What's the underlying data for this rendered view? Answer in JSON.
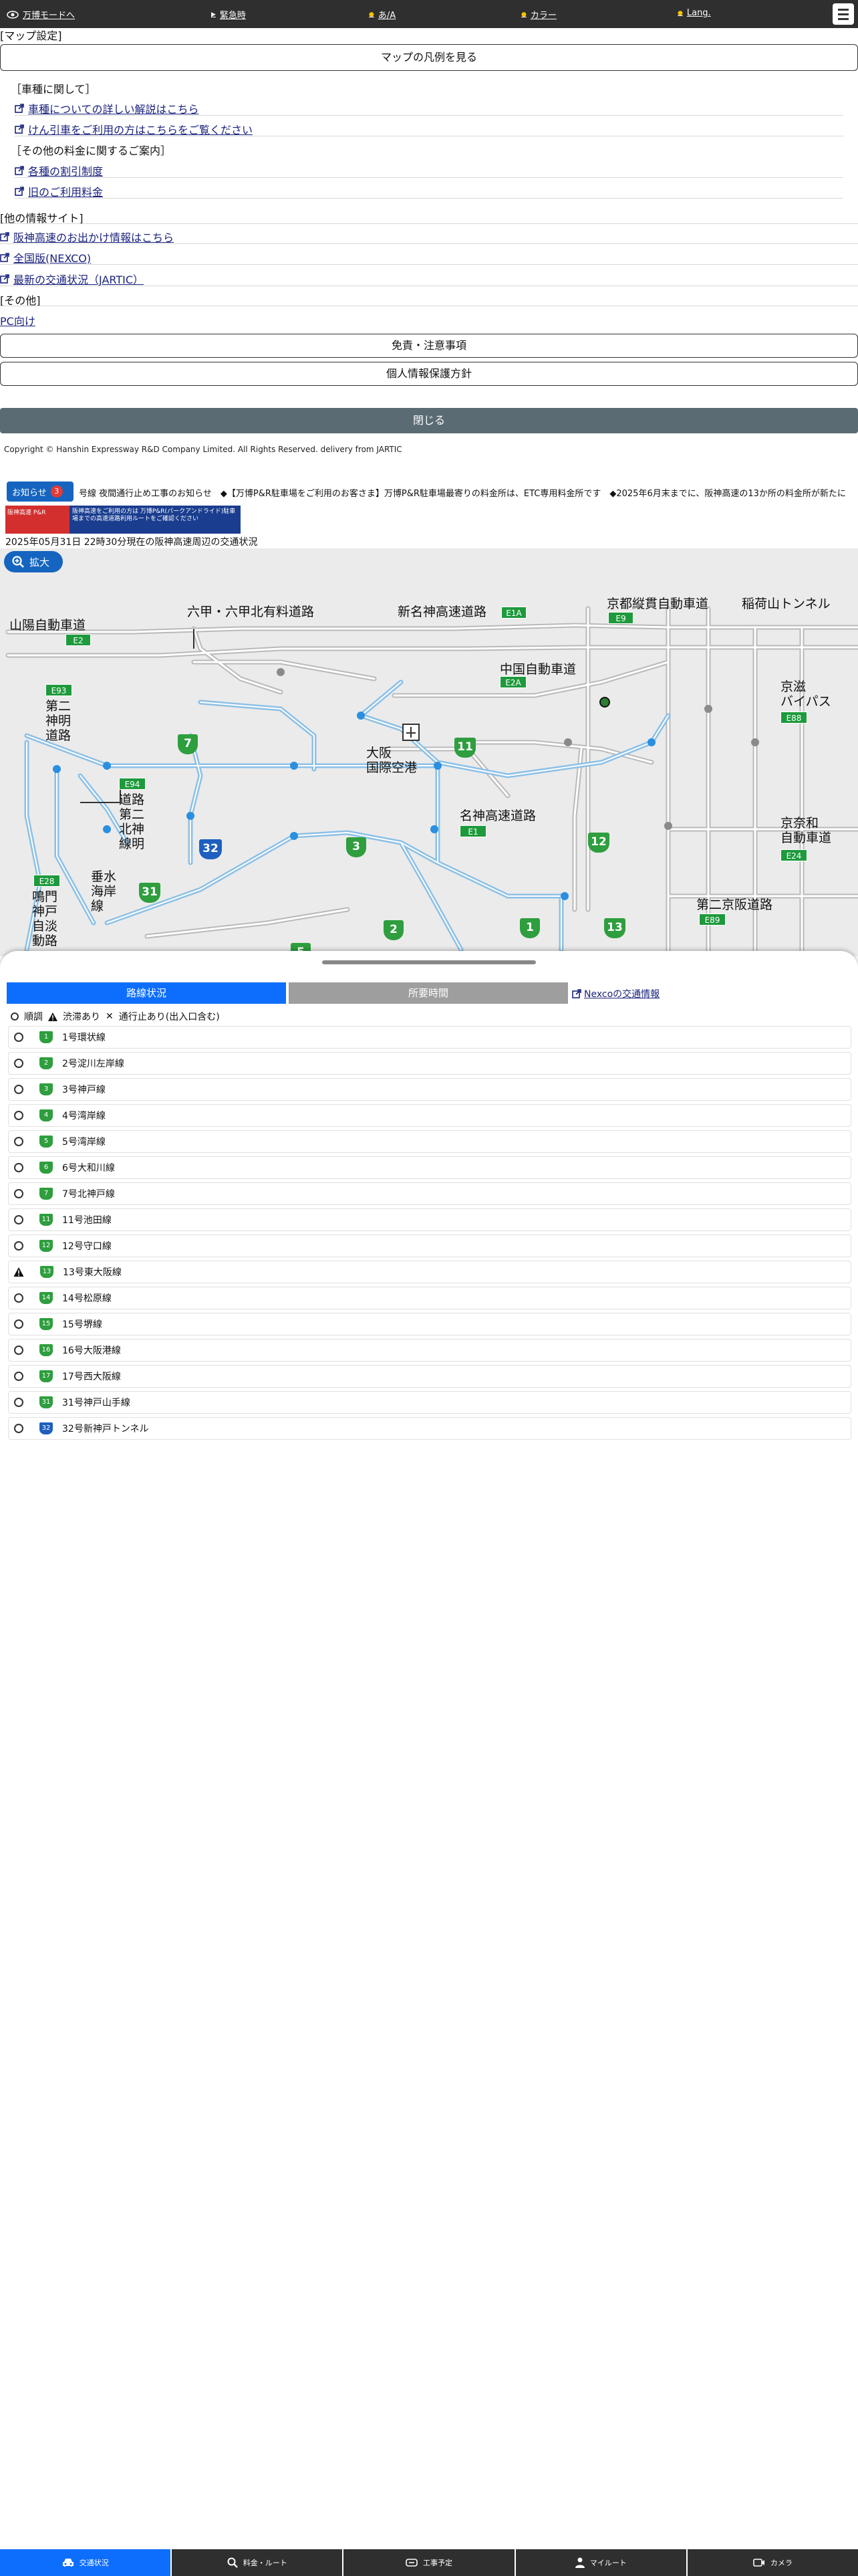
{
  "topbar": {
    "bansaku_mode": "万博モードへ",
    "emergency": "緊急時",
    "kana": "あ/A",
    "color": "カラー",
    "lang": "Lang."
  },
  "map_settings": {
    "heading": "[マップ設定]",
    "legend_button": "マップの凡例を見る"
  },
  "vehicle": {
    "heading": "［車種に関して］",
    "link1": "車種についての詳しい解説はこちら",
    "link2": "けん引車をご利用の方はこちらをご覧ください"
  },
  "other_fees": {
    "heading": "［その他の料金に関するご案内］",
    "link1": "各種の割引制度",
    "link2": "旧のご利用料金"
  },
  "other_sites": {
    "heading": "[他の情報サイト]",
    "link1": "阪神高速のお出かけ情報はこちら",
    "link2": "全国版(NEXCO)",
    "link3": "最新の交通状況（JARTIC）"
  },
  "misc": {
    "heading": "[その他]",
    "pc_link": "PC向け",
    "disclaimer_button": "免責・注意事項",
    "privacy_button": "個人情報保護方針",
    "close_button": "閉じる",
    "copyright": "Copyright © Hanshin Expressway R&D Company Limited. All Rights Reserved. delivery from JARTIC"
  },
  "news": {
    "notice_label": "お知らせ",
    "notice_count": "3",
    "ticker": "号線 夜間通行止め工事のお知らせ　◆【万博P&R駐車場をご利用のお客さま】万博P&R駐車場最寄りの料金所は、ETC専用料金所です　◆2025年6月末までに、阪神高速の13か所の料金所が新たに",
    "banner_left": "阪神高速 P&R",
    "banner_right": "阪神高速をご利用の方は 万博P&R(パークアンドライド)駐車場までの高速道路利用ルートをご確認ください",
    "date_line": "2025年05月31日 22時30分現在の阪神高速周辺の交通状況",
    "zoom_label": "拡大"
  },
  "map": {
    "labels": {
      "sanyo": "山陽自動車道",
      "rokko": "六甲・六甲北有料道路",
      "shinmeishin": "新名神高速道路",
      "keinawa": "京都縦貫自動車道",
      "inariyama": "稲荷山トンネル",
      "chugoku": "中国自動車道",
      "keiji": "京滋\nバイパス",
      "daini_shinmei": "第二\n神明\n道路",
      "daini_hokushin": "道路\n第二\n北神\n線明",
      "airport": "大阪\n国際空港",
      "meishin": "名神高速道路",
      "keinawa2": "京奈和\n自動車道",
      "tarumi": "垂水\n海岸\n線",
      "naruto": "鳴門\n神戸\n自淡\n動路",
      "daini_keihan": "第二京阪道路"
    },
    "shields": {
      "e2": "E2",
      "e1a": "E1A",
      "e9": "E9",
      "e2a": "E2A",
      "e88": "E88",
      "e93": "E93",
      "e94": "E94",
      "e1": "E1",
      "e24": "E24",
      "e28": "E28",
      "e89": "E89"
    },
    "route_nums": {
      "r7": "7",
      "r11": "11",
      "r3": "3",
      "r32": "32",
      "r12": "12",
      "r31": "31",
      "r1": "1",
      "r2": "2",
      "r13": "13",
      "r5": "5"
    }
  },
  "sheet": {
    "tab_route_status": "路線状況",
    "tab_travel_time": "所要時間",
    "nexco_link": "Nexcoの交通情報",
    "legend_normal": "順調",
    "legend_jam": "渋滞あり",
    "legend_closed": "通行止あり(出入口含む)",
    "routes": [
      {
        "num": "1",
        "name": "1号環状線",
        "status": "normal",
        "color": "green"
      },
      {
        "num": "2",
        "name": "2号淀川左岸線",
        "status": "normal",
        "color": "green"
      },
      {
        "num": "3",
        "name": "3号神戸線",
        "status": "normal",
        "color": "green"
      },
      {
        "num": "4",
        "name": "4号湾岸線",
        "status": "normal",
        "color": "green"
      },
      {
        "num": "5",
        "name": "5号湾岸線",
        "status": "normal",
        "color": "green"
      },
      {
        "num": "6",
        "name": "6号大和川線",
        "status": "normal",
        "color": "green"
      },
      {
        "num": "7",
        "name": "7号北神戸線",
        "status": "normal",
        "color": "green"
      },
      {
        "num": "11",
        "name": "11号池田線",
        "status": "normal",
        "color": "green"
      },
      {
        "num": "12",
        "name": "12号守口線",
        "status": "normal",
        "color": "green"
      },
      {
        "num": "13",
        "name": "13号東大阪線",
        "status": "jam",
        "color": "green"
      },
      {
        "num": "14",
        "name": "14号松原線",
        "status": "normal",
        "color": "green"
      },
      {
        "num": "15",
        "name": "15号堺線",
        "status": "normal",
        "color": "green"
      },
      {
        "num": "16",
        "name": "16号大阪港線",
        "status": "normal",
        "color": "green"
      },
      {
        "num": "17",
        "name": "17号西大阪線",
        "status": "normal",
        "color": "green"
      },
      {
        "num": "31",
        "name": "31号神戸山手線",
        "status": "normal",
        "color": "green"
      },
      {
        "num": "32",
        "name": "32号新神戸トンネル",
        "status": "normal",
        "color": "blue"
      }
    ]
  },
  "bottom_nav": {
    "traffic": "交通状況",
    "fare_route": "料金・ルート",
    "construction": "工事予定",
    "my_route": "マイルート",
    "camera": "カメラ"
  },
  "colors": {
    "accent": "#0d6efd",
    "route_green": "#2e9e3e",
    "route_blue": "#1e5fbf",
    "road_light_blue": "#a9d0ef",
    "road_gray": "#c8c8c8"
  }
}
